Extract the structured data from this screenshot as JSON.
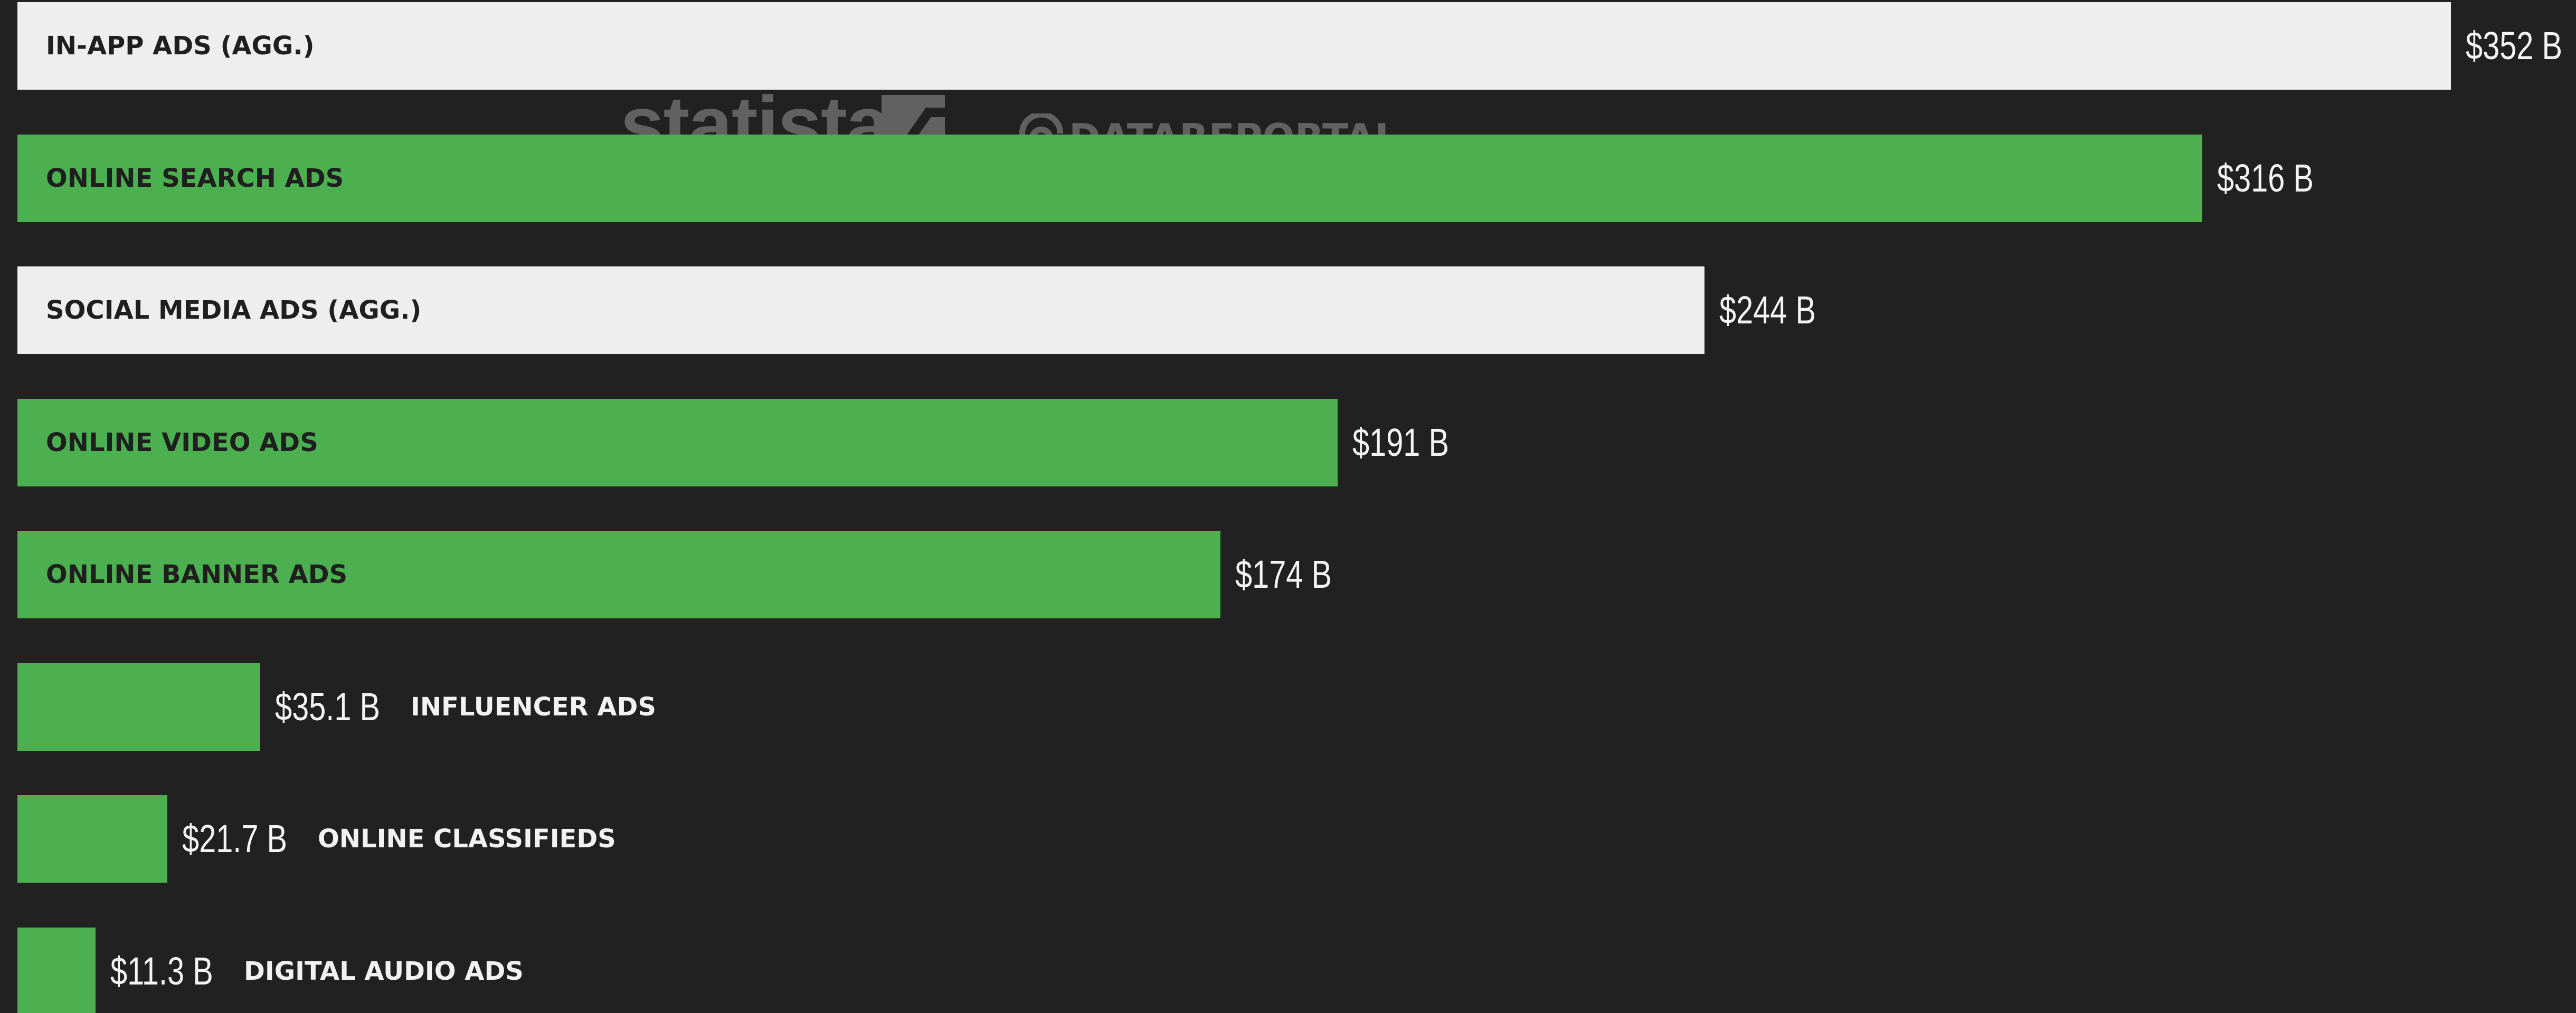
{
  "chart_data": {
    "type": "bar",
    "orientation": "horizontal",
    "categories": [
      "IN-APP ADS (AGG.)",
      "ONLINE SEARCH ADS",
      "SOCIAL MEDIA ADS (AGG.)",
      "ONLINE VIDEO ADS",
      "ONLINE BANNER ADS",
      "INFLUENCER ADS",
      "ONLINE CLASSIFIEDS",
      "DIGITAL AUDIO ADS"
    ],
    "values": [
      352,
      316,
      244,
      191,
      174,
      35.1,
      21.7,
      11.3
    ],
    "value_labels": [
      "$352 B",
      "$316 B",
      "$244 B",
      "$191 B",
      "$174 B",
      "$35.1 B",
      "$21.7 B",
      "$11.3 B"
    ],
    "aggregate": [
      true,
      false,
      true,
      false,
      false,
      false,
      false,
      false
    ],
    "title": "",
    "xlabel": "",
    "ylabel": "",
    "xlim": [
      0,
      352
    ],
    "grid": false,
    "legend": "none"
  },
  "watermarks": {
    "statista": "statista",
    "datareportal": "DATAREPORTAL"
  },
  "colors": {
    "background": "#212121",
    "bar": "#4caf50",
    "aggregate_bar": "#eeeeee",
    "label_dark": "#1f1f1f",
    "label_light": "#f2f2f2"
  }
}
